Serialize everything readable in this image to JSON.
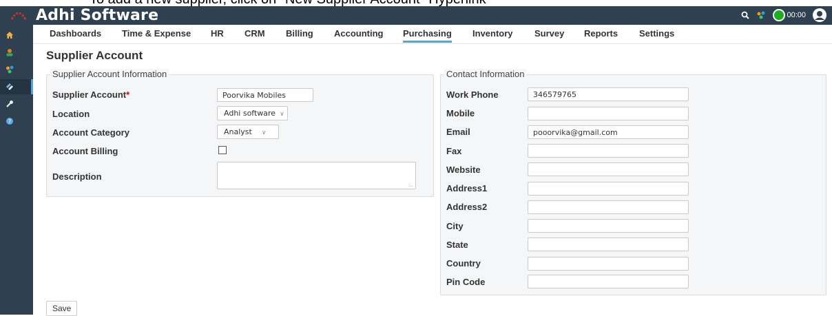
{
  "caption": "To add a new supplier, click on \"New Supplier Account\" Hyperlink",
  "app": {
    "brand": "Adhi Software",
    "timer": "00:00"
  },
  "nav": {
    "items": [
      "Dashboards",
      "Time & Expense",
      "HR",
      "CRM",
      "Billing",
      "Accounting",
      "Purchasing",
      "Inventory",
      "Survey",
      "Reports",
      "Settings"
    ],
    "active": "Purchasing"
  },
  "sidebar": {
    "icons": [
      "home-icon",
      "user-icon",
      "apps-icon",
      "purchasing-icon",
      "wrench-icon",
      "help-icon"
    ],
    "active": "purchasing-icon"
  },
  "page": {
    "title": "Supplier Account"
  },
  "supplier_info": {
    "legend": "Supplier Account Information",
    "supplier_account_label": "Supplier Account",
    "required_mark": "*",
    "supplier_account_value": "Poorvika Mobiles",
    "location_label": "Location",
    "location_value": "Adhi software",
    "account_category_label": "Account Category",
    "account_category_value": "Analyst",
    "account_billing_label": "Account Billing",
    "account_billing_checked": false,
    "description_label": "Description",
    "description_value": ""
  },
  "contact_info": {
    "legend": "Contact Information",
    "work_phone_label": "Work Phone",
    "work_phone_value": "346579765",
    "mobile_label": "Mobile",
    "mobile_value": "",
    "email_label": "Email",
    "email_value": "pooorvika@gmail.com",
    "fax_label": "Fax",
    "fax_value": "",
    "website_label": "Website",
    "website_value": "",
    "address1_label": "Address1",
    "address1_value": "",
    "address2_label": "Address2",
    "address2_value": "",
    "city_label": "City",
    "city_value": "",
    "state_label": "State",
    "state_value": "",
    "country_label": "Country",
    "country_value": "",
    "pin_code_label": "Pin Code",
    "pin_code_value": ""
  },
  "actions": {
    "save_label": "Save"
  },
  "colors": {
    "topbar": "#2f4050",
    "accent": "#5aa2d8",
    "timer_green": "#1ab01a",
    "required": "#dd0000"
  }
}
